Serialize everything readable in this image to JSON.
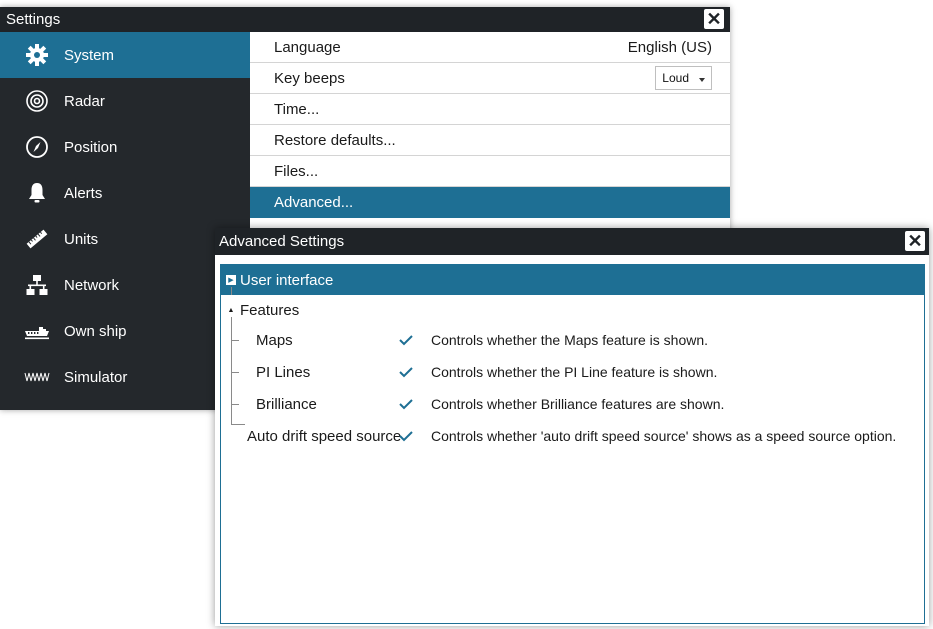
{
  "settings": {
    "title": "Settings",
    "close_glyph": "✕",
    "sidebar": [
      {
        "label": "System",
        "icon": "gear-icon",
        "active": true
      },
      {
        "label": "Radar",
        "icon": "radar-icon"
      },
      {
        "label": "Position",
        "icon": "compass-icon"
      },
      {
        "label": "Alerts",
        "icon": "bell-icon"
      },
      {
        "label": "Units",
        "icon": "ruler-icon"
      },
      {
        "label": "Network",
        "icon": "network-icon"
      },
      {
        "label": "Own ship",
        "icon": "ship-icon"
      },
      {
        "label": "Simulator",
        "icon": "waveform-icon"
      }
    ],
    "rows": {
      "language_label": "Language",
      "language_value": "English (US)",
      "key_beeps_label": "Key beeps",
      "key_beeps_value": "Loud",
      "time_label": "Time...",
      "restore_label": "Restore defaults...",
      "files_label": "Files...",
      "advanced_label": "Advanced..."
    }
  },
  "advanced": {
    "title": "Advanced Settings",
    "close_glyph": "✕",
    "user_interface_label": "User interface",
    "features_label": "Features",
    "features": [
      {
        "label": "Maps",
        "checked": true,
        "description": "Controls whether the Maps feature is shown."
      },
      {
        "label": "PI Lines",
        "checked": true,
        "description": "Controls whether the PI Line feature is shown."
      },
      {
        "label": "Brilliance",
        "checked": true,
        "description": "Controls whether Brilliance features are shown."
      },
      {
        "label": "Auto drift speed source",
        "checked": true,
        "description": "Controls whether 'auto drift speed source' shows as a speed source option."
      }
    ]
  },
  "colors": {
    "accent": "#1e6f94",
    "titlebar": "#1f2327",
    "sidebar": "#24282c"
  }
}
